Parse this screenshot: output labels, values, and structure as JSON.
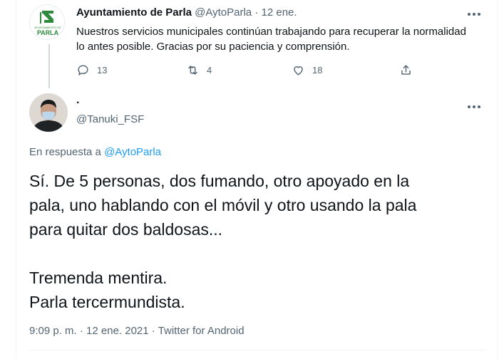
{
  "parent_tweet": {
    "display_name": "Ayuntamiento de Parla",
    "handle": "@AytoParla",
    "separator": "·",
    "date": "12 ene.",
    "text": "Nuestros servicios municipales continúan trabajando para recuperar la normalidad lo antes posible. Gracias por su paciencia y comprensión.",
    "logo_text": "PARLA",
    "logo_subtext": "AYUNTAMIENTO DE",
    "counts": {
      "replies": "13",
      "retweets": "4",
      "likes": "18"
    },
    "icons": [
      "reply-icon",
      "retweet-icon",
      "like-icon",
      "share-icon"
    ]
  },
  "main_tweet": {
    "display_name": ".",
    "handle": "@Tanuki_FSF",
    "reply_prefix": "En respuesta a",
    "reply_to": "@AytoParla",
    "lines": [
      "Sí. De 5 personas, dos fumando, otro apoyado en la",
      "pala, uno hablando con el móvil y otro usando la pala",
      "para quitar dos baldosas...",
      "",
      "Tremenda mentira.",
      "Parla tercermundista."
    ],
    "meta": "9:09 p. m. · 12 ene. 2021 · Twitter for Android"
  },
  "colors": {
    "accent": "#1d9bf0",
    "muted": "#536471",
    "text": "#0f1419",
    "logo_green": "#2e8b3d"
  }
}
